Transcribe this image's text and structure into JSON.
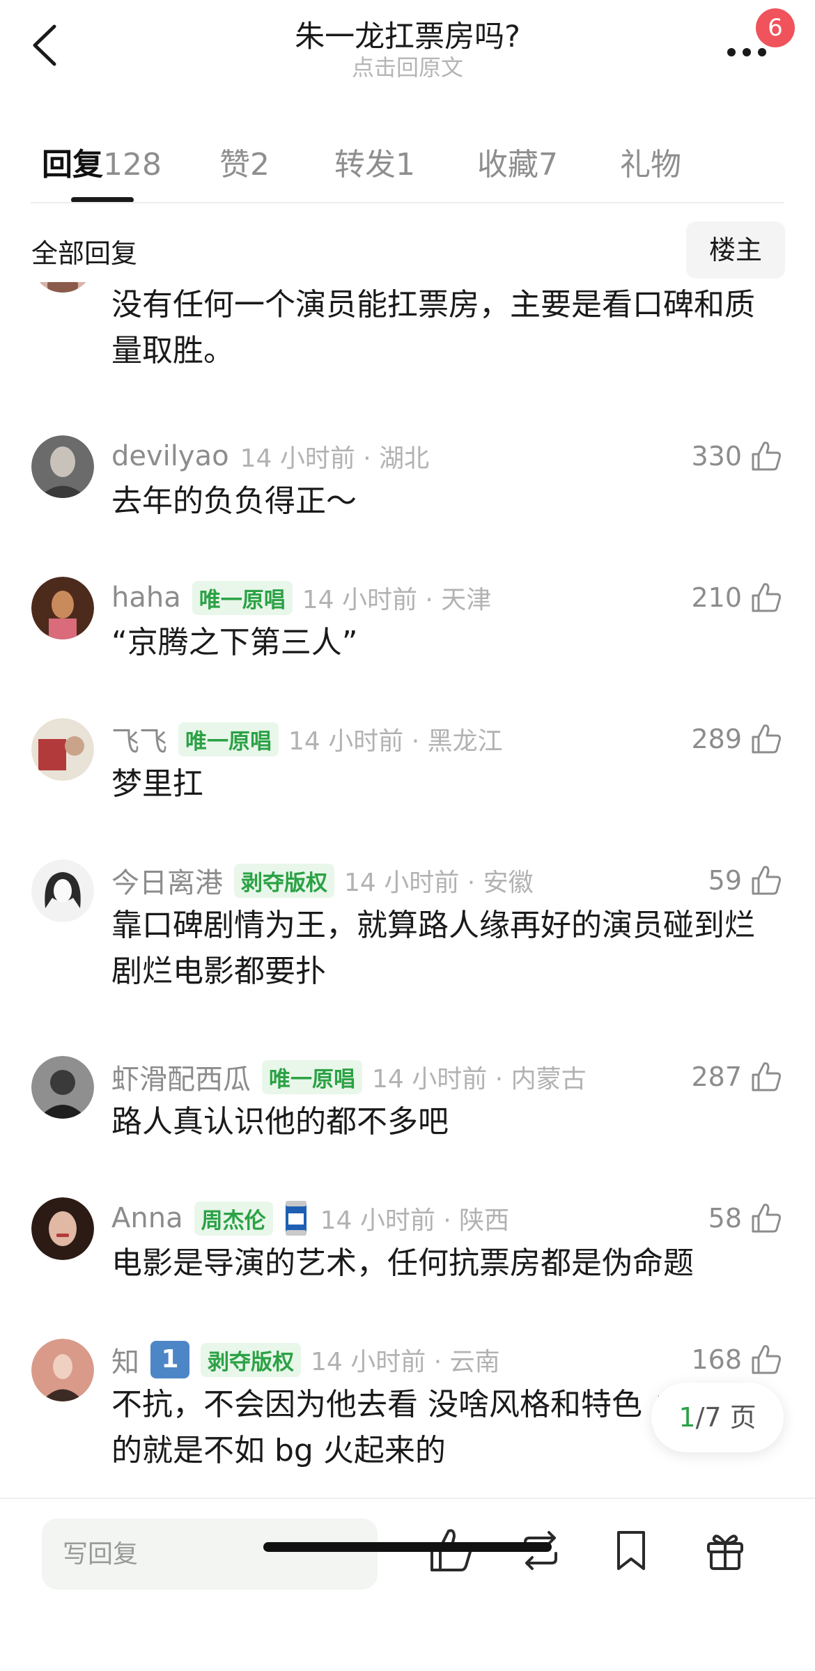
{
  "header": {
    "title": "朱一龙扛票房吗?",
    "subtitle": "点击回原文",
    "notification_count": "6"
  },
  "tabs": [
    {
      "label": "回复",
      "count": "128"
    },
    {
      "label": "赞",
      "count": "2"
    },
    {
      "label": "转发",
      "count": "1"
    },
    {
      "label": "收藏",
      "count": "7"
    },
    {
      "label": "礼物",
      "count": ""
    }
  ],
  "filter": {
    "label": "全部回复",
    "owner_button": "楼主"
  },
  "comments": [
    {
      "username": "",
      "tags": [],
      "time": "",
      "likes": "",
      "text": "没有任何一个演员能扛票房，主要是看口碑和质量取胜。",
      "avatar_colors": [
        "#d8b4a6",
        "#8a5a4a"
      ]
    },
    {
      "username": "devilyao",
      "tags": [],
      "time": "14 小时前 · 湖北",
      "likes": "330",
      "text": "去年的负负得正～",
      "avatar_colors": [
        "#6b6b6b",
        "#c9c2bb"
      ]
    },
    {
      "username": "haha",
      "tags": [
        "唯一原唱"
      ],
      "time": "14 小时前 · 天津",
      "likes": "210",
      "text": "“京腾之下第三人”",
      "avatar_colors": [
        "#c98a5c",
        "#4d2b1c"
      ]
    },
    {
      "username": "飞飞",
      "tags": [
        "唯一原唱"
      ],
      "time": "14 小时前 · 黑龙江",
      "likes": "289",
      "text": "梦里扛",
      "avatar_colors": [
        "#b33a3a",
        "#e9e2d7"
      ]
    },
    {
      "username": "今日离港",
      "tags": [
        "剥夺版权"
      ],
      "time": "14 小时前 · 安徽",
      "likes": "59",
      "text": "靠口碑剧情为王，就算路人缘再好的演员碰到烂剧烂电影都要扑",
      "avatar_colors": [
        "#f2f2f2",
        "#2a2a2a"
      ]
    },
    {
      "username": "虾滑配西瓜",
      "tags": [
        "唯一原唱"
      ],
      "time": "14 小时前 · 内蒙古",
      "likes": "287",
      "text": "路人真认识他的都不多吧",
      "avatar_colors": [
        "#3a3a3a",
        "#8f8f8f"
      ]
    },
    {
      "username": "Anna",
      "tags": [
        "周杰伦"
      ],
      "badge_emoji": "beer-can",
      "time": "14 小时前 · 陕西",
      "likes": "58",
      "text": "电影是导演的艺术，任何抗票房都是伪命题",
      "avatar_colors": [
        "#b77f6a",
        "#2c1a15"
      ]
    },
    {
      "username": "知",
      "level": "1",
      "tags": [
        "剥夺版权"
      ],
      "time": "14 小时前 · 云南",
      "likes": "168",
      "text": "不抗，不会因为他去看 没啥风格和特色 火起来的就是不如 bg 火起来的",
      "avatar_colors": [
        "#d99a8a",
        "#3b2b24"
      ]
    }
  ],
  "pager": {
    "current": "1",
    "total": "/7 页"
  },
  "bottom_bar": {
    "reply_placeholder": "写回复"
  },
  "colors": {
    "tag_green": "#2ba245",
    "tag_bg": "#e9f6ea",
    "badge_red": "#f0535b",
    "level_blue": "#4d86c6"
  }
}
